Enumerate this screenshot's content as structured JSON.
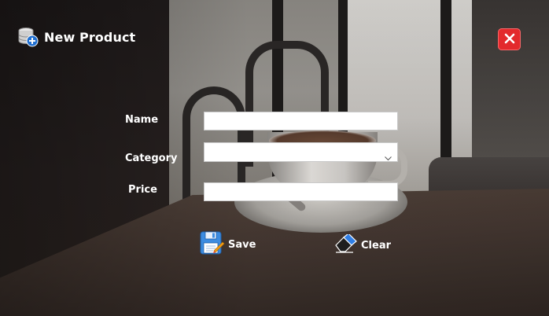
{
  "window": {
    "title": "New Product",
    "icons": {
      "app": "database-icon",
      "close": "close-icon"
    }
  },
  "form": {
    "name": {
      "label": "Name",
      "value": ""
    },
    "category": {
      "label": "Category",
      "value": ""
    },
    "price": {
      "label": "Price",
      "value": ""
    }
  },
  "actions": {
    "save": {
      "label": "Save",
      "icon": "floppy-disk-icon"
    },
    "clear": {
      "label": "Clear",
      "icon": "eraser-icon"
    }
  },
  "colors": {
    "close_button": "#e3292c",
    "label_text": "#ffffff",
    "field_background": "#ffffff"
  }
}
